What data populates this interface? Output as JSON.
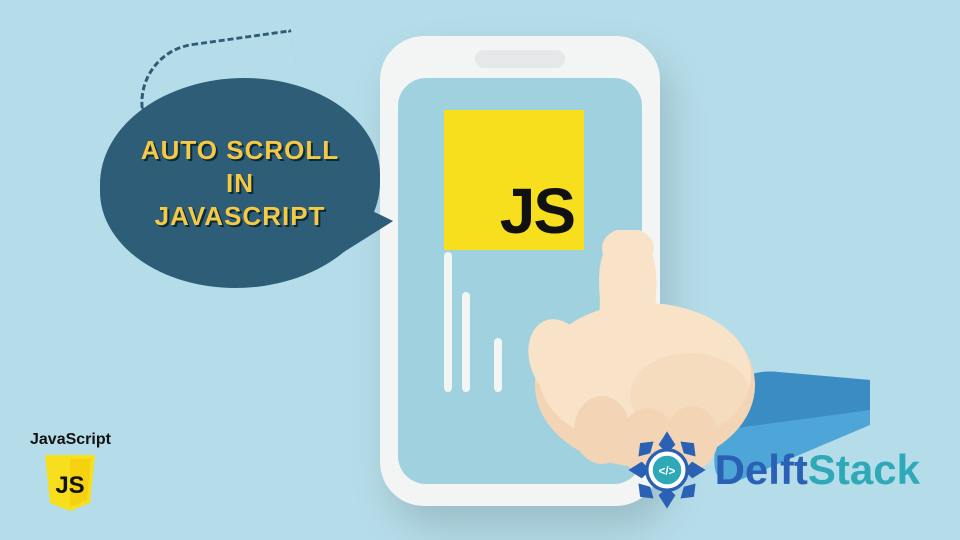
{
  "bubble": {
    "line1": "AUTO SCROLL",
    "line2": "IN",
    "line3": "JAVASCRIPT"
  },
  "phone_logo": {
    "js": "JS"
  },
  "bottom_badge": {
    "label": "JavaScript",
    "js": "JS"
  },
  "brand": {
    "part1": "Delft",
    "part2": "Stack",
    "icon_code": "</>"
  }
}
